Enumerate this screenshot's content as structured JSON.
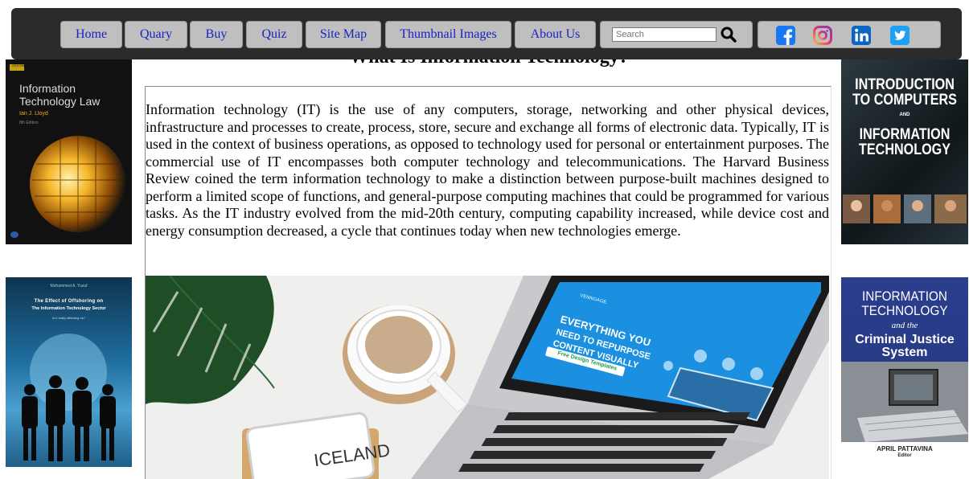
{
  "nav": {
    "items": [
      "Home",
      "Quary",
      "Buy",
      "Quiz",
      "Site Map",
      "Thumbnail Images",
      "About Us"
    ],
    "search_placeholder": "Search",
    "social": [
      "facebook-icon",
      "instagram-icon",
      "linkedin-icon",
      "twitter-icon"
    ]
  },
  "main": {
    "heading": "What Is Information Technology?",
    "paragraph": "Information technology (IT) is the use of any computers, storage, networking and other physical devices, infrastructure and processes to create, process, store, secure and exchange all forms of electronic data. Typically, IT is used in the context of business operations, as opposed to technology used for personal or entertainment purposes. The commercial use of IT encompasses both computer technology and telecommunications. The Harvard Business Review coined the term information technology to make a distinction between purpose-built machines designed to perform a limited scope of functions, and general-purpose computing machines that could be programmed for various tasks. As the IT industry evolved from the mid-20th century, computing capability increased, while device cost and energy consumption decreased, a cycle that continues today when new technologies emerge."
  },
  "hero": {
    "screen_text_1": "EVERYTHING YOU",
    "screen_text_2": "NEED TO REPURPOSE",
    "screen_text_3": "CONTENT VISUALLY",
    "screen_badge": "Free Design Templates",
    "screen_brand": "VENNGAGE",
    "tablet_text": "ICELAND"
  },
  "books": {
    "left1": {
      "publisher": "OXFORD",
      "title1": "Information",
      "title2": "Technology Law",
      "author": "Ian J. Lloyd",
      "edition": "8th Edition"
    },
    "left2": {
      "author": "Mohammed A. Yusuf",
      "title1": "The Effect of Offshoring on",
      "title2": "The Information Technology Sector",
      "subtitle": "Is it really affecting us?"
    },
    "right1": {
      "title1": "INTRODUCTION",
      "title2": "TO COMPUTERS",
      "and": "AND",
      "title3": "INFORMATION",
      "title4": "TECHNOLOGY"
    },
    "right2": {
      "title1": "INFORMATION",
      "title2": "TECHNOLOGY",
      "and": "and the",
      "title3": "Criminal Justice",
      "title4": "System",
      "author": "APRIL PATTAVINA",
      "role": "Editor"
    }
  },
  "colors": {
    "nav_bg": "#2b2b2b",
    "btn_bg": "#bfbfbf",
    "link": "#1a23c2"
  }
}
